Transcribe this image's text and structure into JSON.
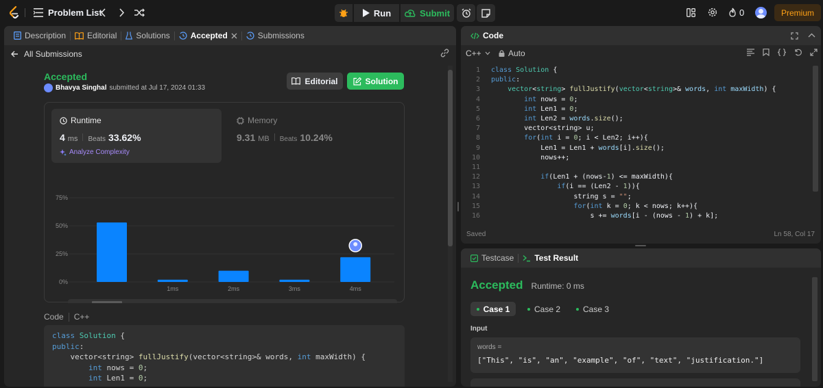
{
  "topbar": {
    "problem_list": "Problem List",
    "run": "Run",
    "submit": "Submit",
    "streak": "0",
    "premium": "Premium"
  },
  "left_panel": {
    "tabs": [
      {
        "label": "Description"
      },
      {
        "label": "Editorial"
      },
      {
        "label": "Solutions"
      },
      {
        "label": "Accepted"
      },
      {
        "label": "Submissions"
      }
    ],
    "back_label": "All Submissions",
    "status": "Accepted",
    "user": "Bhavya Singhal",
    "submitted_text": "submitted at Jul 17, 2024 01:33",
    "editorial_btn": "Editorial",
    "solution_btn": "Solution",
    "runtime": {
      "title": "Runtime",
      "value": "4",
      "unit": "ms",
      "beats_label": "Beats",
      "beats_value": "33.62%",
      "analyze": "Analyze Complexity"
    },
    "memory": {
      "title": "Memory",
      "value": "9.31",
      "unit": "MB",
      "beats_label": "Beats",
      "beats_value": "10.24%"
    },
    "code_label": "Code",
    "code_lang": "C++",
    "code_snippet": [
      "class Solution {",
      "public:",
      "    vector<string> fullJustify(vector<string>& words, int maxWidth) {",
      "        int nows = 0;",
      "        int Len1 = 0;"
    ]
  },
  "chart_data": {
    "type": "bar",
    "categories": [
      "",
      "1ms",
      "2ms",
      "3ms",
      "4ms"
    ],
    "values": [
      53,
      2,
      10,
      2,
      22
    ],
    "y_ticks": [
      "75%",
      "50%",
      "25%",
      "0%"
    ],
    "ylim": [
      0,
      75
    ],
    "mini_categories": [
      "1ms",
      "2ms",
      "3ms",
      "4ms"
    ],
    "highlight_category": "4ms",
    "bar_color": "#0a84ff"
  },
  "editor": {
    "title": "Code",
    "lang": "C++",
    "mode": "Auto",
    "status": "Saved",
    "cursor": "Ln 58, Col 17",
    "lines": [
      "class Solution {",
      "public:",
      "    vector<string> fullJustify(vector<string>& words, int maxWidth) {",
      "        int nows = 0;",
      "        int Len1 = 0;",
      "        int Len2 = words.size();",
      "        vector<string> u;",
      "        for(int i = 0; i < Len2; i++){",
      "            Len1 = Len1 + words[i].size();",
      "            nows++;",
      "",
      "            if(Len1 + (nows-1) <= maxWidth){",
      "                if(i == (Len2 - 1)){",
      "                    string s = \"\";",
      "                    for(int k = 0; k < nows; k++){",
      "                        s += words[i - (nows - 1) + k];"
    ]
  },
  "testpanel": {
    "tab_testcase": "Testcase",
    "tab_result": "Test Result",
    "status": "Accepted",
    "runtime": "Runtime: 0 ms",
    "cases": [
      "Case 1",
      "Case 2",
      "Case 3"
    ],
    "input_label": "Input",
    "var_label": "words =",
    "var_value": "[\"This\", \"is\", \"an\", \"example\", \"of\", \"text\", \"justification.\"]"
  },
  "colors": {
    "accent_green": "#2cbb5d",
    "accent_orange": "#ffa116",
    "bar_blue": "#0a84ff"
  }
}
